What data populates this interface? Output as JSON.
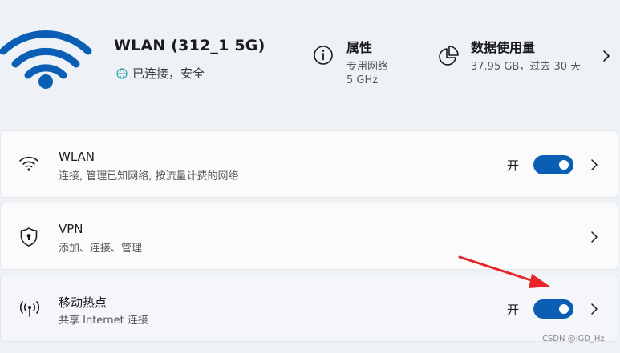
{
  "network": {
    "name": "WLAN (312_1 5G)",
    "status": "已连接，安全"
  },
  "properties": {
    "title": "属性",
    "line1": "专用网络",
    "line2": "5 GHz"
  },
  "data_usage": {
    "title": "数据使用量",
    "detail": "37.95 GB，过去 30 天"
  },
  "cards": [
    {
      "title": "WLAN",
      "subtitle": "连接, 管理已知网络, 按流量计费的网络",
      "toggle_label": "开",
      "toggle_on": true
    },
    {
      "title": "VPN",
      "subtitle": "添加、连接、管理"
    },
    {
      "title": "移动热点",
      "subtitle": "共享 Internet 连接",
      "toggle_label": "开",
      "toggle_on": true
    }
  ],
  "watermark": "CSDN @iGD_Hz",
  "colors": {
    "accent": "#0a5fb4",
    "annotation_arrow": "#e8262a",
    "status_globe": "#2aa3a8"
  }
}
